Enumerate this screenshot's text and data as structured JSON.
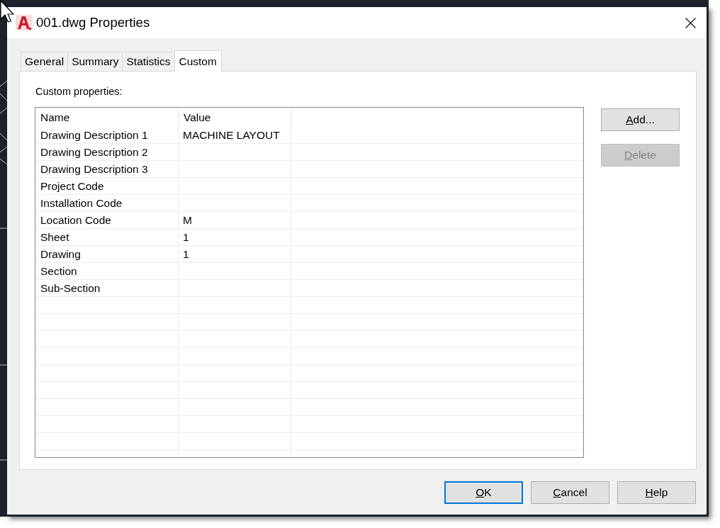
{
  "window": {
    "title": "001.dwg Properties"
  },
  "tabs": [
    {
      "label": "General",
      "selected": false
    },
    {
      "label": "Summary",
      "selected": false
    },
    {
      "label": "Statistics",
      "selected": false
    },
    {
      "label": "Custom",
      "selected": true
    }
  ],
  "panel": {
    "heading": "Custom properties:"
  },
  "table": {
    "columns": [
      "Name",
      "Value"
    ],
    "rows": [
      {
        "name": "Drawing Description 1",
        "value": "MACHINE LAYOUT"
      },
      {
        "name": "Drawing Description 2"
      },
      {
        "name": "Drawing Description 3"
      },
      {
        "name": "Project Code"
      },
      {
        "name": "Installation Code"
      },
      {
        "name": "Location Code",
        "value": "M"
      },
      {
        "name": "Sheet",
        "value": "1"
      },
      {
        "name": "Drawing",
        "value": "1"
      },
      {
        "name": "Section"
      },
      {
        "name": "Sub-Section"
      }
    ]
  },
  "side_buttons": [
    {
      "label": "Add...",
      "disabled": false,
      "underline_first": true
    },
    {
      "label": "Delete",
      "disabled": true,
      "underline_first": true
    }
  ],
  "buttons": [
    {
      "label": "OK",
      "default": true,
      "underline_first": true
    },
    {
      "label": "Cancel",
      "default": false,
      "underline_first": true
    },
    {
      "label": "Help",
      "default": false,
      "underline_first": true
    }
  ]
}
